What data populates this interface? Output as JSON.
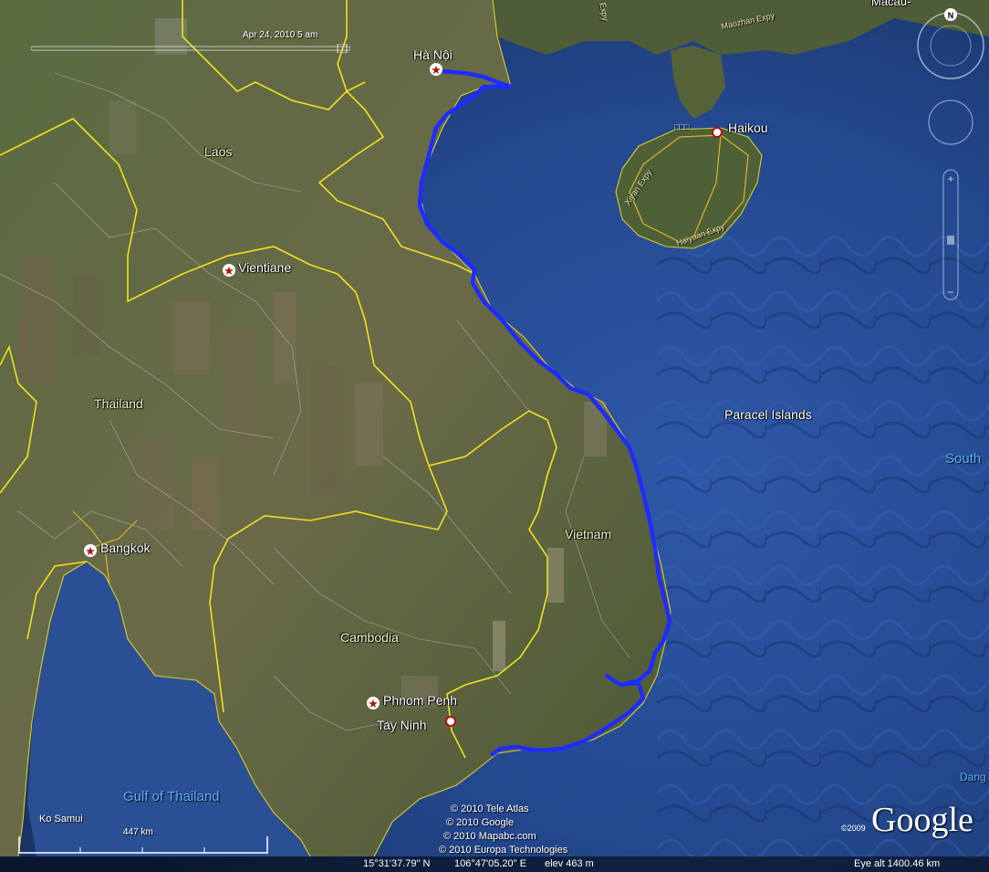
{
  "map": {
    "timestamp": "Apr 24, 2010   5 am",
    "countries": {
      "laos": "Laos",
      "thailand": "Thailand",
      "cambodia": "Cambodia",
      "vietnam": "Vietnam"
    },
    "cities": {
      "hanoi": "Hà Nội",
      "vientiane": "Vientiane",
      "bangkok": "Bangkok",
      "phnom_penh": "Phnom Penh",
      "tay_ninh": "Tay Ninh",
      "haikou": "Haikou",
      "ko_samui": "Ko Samui"
    },
    "water": {
      "gulf_of_thailand": "Gulf of Thailand",
      "paracel_islands": "Paracel Islands",
      "south_edge": "South",
      "dang_edge": "Dang"
    },
    "roads": {
      "xiyan": "Xiyan Expy",
      "haiyuan": "Haiyuan Expy",
      "maozhan": "Maozhan Expy",
      "expy_top": "Expy",
      "macau_edge": "Macau-",
      "boxes": "□□□"
    },
    "credits": [
      "© 2010 Tele Atlas",
      "© 2010 Google",
      "© 2010 Mapabc.com",
      "© 2010 Europa Technologies"
    ],
    "scale_label": "447 km",
    "logo_text": "Google",
    "logo_year": "©2009",
    "compass_letter": "N",
    "status": {
      "lat": "15°31'37.79\" N",
      "lon": "106°47'05.20\" E",
      "elev": "elev  463 m",
      "eye_alt": "Eye alt  1400.46 km"
    },
    "colors": {
      "route": "#1e2cff",
      "border": "#f0e020",
      "sea": "#2a4f97",
      "land": "#5e6a3e"
    }
  }
}
